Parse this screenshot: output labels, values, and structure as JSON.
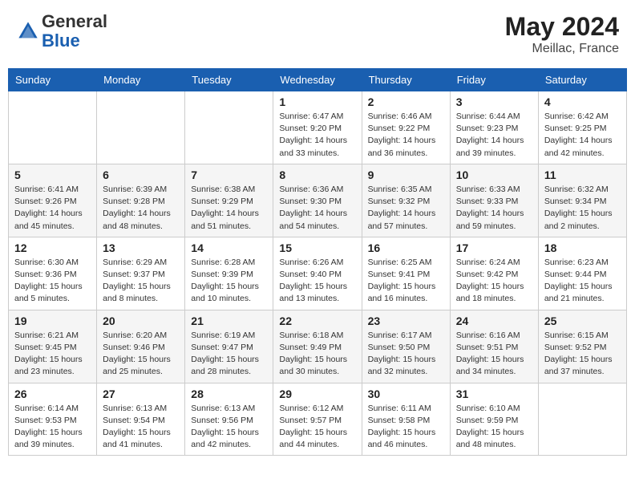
{
  "header": {
    "logo_general": "General",
    "logo_blue": "Blue",
    "month_year": "May 2024",
    "location": "Meillac, France"
  },
  "days_of_week": [
    "Sunday",
    "Monday",
    "Tuesday",
    "Wednesday",
    "Thursday",
    "Friday",
    "Saturday"
  ],
  "weeks": [
    [
      {
        "day": "",
        "sunrise": "",
        "sunset": "",
        "daylight": ""
      },
      {
        "day": "",
        "sunrise": "",
        "sunset": "",
        "daylight": ""
      },
      {
        "day": "",
        "sunrise": "",
        "sunset": "",
        "daylight": ""
      },
      {
        "day": "1",
        "sunrise": "Sunrise: 6:47 AM",
        "sunset": "Sunset: 9:20 PM",
        "daylight": "Daylight: 14 hours and 33 minutes."
      },
      {
        "day": "2",
        "sunrise": "Sunrise: 6:46 AM",
        "sunset": "Sunset: 9:22 PM",
        "daylight": "Daylight: 14 hours and 36 minutes."
      },
      {
        "day": "3",
        "sunrise": "Sunrise: 6:44 AM",
        "sunset": "Sunset: 9:23 PM",
        "daylight": "Daylight: 14 hours and 39 minutes."
      },
      {
        "day": "4",
        "sunrise": "Sunrise: 6:42 AM",
        "sunset": "Sunset: 9:25 PM",
        "daylight": "Daylight: 14 hours and 42 minutes."
      }
    ],
    [
      {
        "day": "5",
        "sunrise": "Sunrise: 6:41 AM",
        "sunset": "Sunset: 9:26 PM",
        "daylight": "Daylight: 14 hours and 45 minutes."
      },
      {
        "day": "6",
        "sunrise": "Sunrise: 6:39 AM",
        "sunset": "Sunset: 9:28 PM",
        "daylight": "Daylight: 14 hours and 48 minutes."
      },
      {
        "day": "7",
        "sunrise": "Sunrise: 6:38 AM",
        "sunset": "Sunset: 9:29 PM",
        "daylight": "Daylight: 14 hours and 51 minutes."
      },
      {
        "day": "8",
        "sunrise": "Sunrise: 6:36 AM",
        "sunset": "Sunset: 9:30 PM",
        "daylight": "Daylight: 14 hours and 54 minutes."
      },
      {
        "day": "9",
        "sunrise": "Sunrise: 6:35 AM",
        "sunset": "Sunset: 9:32 PM",
        "daylight": "Daylight: 14 hours and 57 minutes."
      },
      {
        "day": "10",
        "sunrise": "Sunrise: 6:33 AM",
        "sunset": "Sunset: 9:33 PM",
        "daylight": "Daylight: 14 hours and 59 minutes."
      },
      {
        "day": "11",
        "sunrise": "Sunrise: 6:32 AM",
        "sunset": "Sunset: 9:34 PM",
        "daylight": "Daylight: 15 hours and 2 minutes."
      }
    ],
    [
      {
        "day": "12",
        "sunrise": "Sunrise: 6:30 AM",
        "sunset": "Sunset: 9:36 PM",
        "daylight": "Daylight: 15 hours and 5 minutes."
      },
      {
        "day": "13",
        "sunrise": "Sunrise: 6:29 AM",
        "sunset": "Sunset: 9:37 PM",
        "daylight": "Daylight: 15 hours and 8 minutes."
      },
      {
        "day": "14",
        "sunrise": "Sunrise: 6:28 AM",
        "sunset": "Sunset: 9:39 PM",
        "daylight": "Daylight: 15 hours and 10 minutes."
      },
      {
        "day": "15",
        "sunrise": "Sunrise: 6:26 AM",
        "sunset": "Sunset: 9:40 PM",
        "daylight": "Daylight: 15 hours and 13 minutes."
      },
      {
        "day": "16",
        "sunrise": "Sunrise: 6:25 AM",
        "sunset": "Sunset: 9:41 PM",
        "daylight": "Daylight: 15 hours and 16 minutes."
      },
      {
        "day": "17",
        "sunrise": "Sunrise: 6:24 AM",
        "sunset": "Sunset: 9:42 PM",
        "daylight": "Daylight: 15 hours and 18 minutes."
      },
      {
        "day": "18",
        "sunrise": "Sunrise: 6:23 AM",
        "sunset": "Sunset: 9:44 PM",
        "daylight": "Daylight: 15 hours and 21 minutes."
      }
    ],
    [
      {
        "day": "19",
        "sunrise": "Sunrise: 6:21 AM",
        "sunset": "Sunset: 9:45 PM",
        "daylight": "Daylight: 15 hours and 23 minutes."
      },
      {
        "day": "20",
        "sunrise": "Sunrise: 6:20 AM",
        "sunset": "Sunset: 9:46 PM",
        "daylight": "Daylight: 15 hours and 25 minutes."
      },
      {
        "day": "21",
        "sunrise": "Sunrise: 6:19 AM",
        "sunset": "Sunset: 9:47 PM",
        "daylight": "Daylight: 15 hours and 28 minutes."
      },
      {
        "day": "22",
        "sunrise": "Sunrise: 6:18 AM",
        "sunset": "Sunset: 9:49 PM",
        "daylight": "Daylight: 15 hours and 30 minutes."
      },
      {
        "day": "23",
        "sunrise": "Sunrise: 6:17 AM",
        "sunset": "Sunset: 9:50 PM",
        "daylight": "Daylight: 15 hours and 32 minutes."
      },
      {
        "day": "24",
        "sunrise": "Sunrise: 6:16 AM",
        "sunset": "Sunset: 9:51 PM",
        "daylight": "Daylight: 15 hours and 34 minutes."
      },
      {
        "day": "25",
        "sunrise": "Sunrise: 6:15 AM",
        "sunset": "Sunset: 9:52 PM",
        "daylight": "Daylight: 15 hours and 37 minutes."
      }
    ],
    [
      {
        "day": "26",
        "sunrise": "Sunrise: 6:14 AM",
        "sunset": "Sunset: 9:53 PM",
        "daylight": "Daylight: 15 hours and 39 minutes."
      },
      {
        "day": "27",
        "sunrise": "Sunrise: 6:13 AM",
        "sunset": "Sunset: 9:54 PM",
        "daylight": "Daylight: 15 hours and 41 minutes."
      },
      {
        "day": "28",
        "sunrise": "Sunrise: 6:13 AM",
        "sunset": "Sunset: 9:56 PM",
        "daylight": "Daylight: 15 hours and 42 minutes."
      },
      {
        "day": "29",
        "sunrise": "Sunrise: 6:12 AM",
        "sunset": "Sunset: 9:57 PM",
        "daylight": "Daylight: 15 hours and 44 minutes."
      },
      {
        "day": "30",
        "sunrise": "Sunrise: 6:11 AM",
        "sunset": "Sunset: 9:58 PM",
        "daylight": "Daylight: 15 hours and 46 minutes."
      },
      {
        "day": "31",
        "sunrise": "Sunrise: 6:10 AM",
        "sunset": "Sunset: 9:59 PM",
        "daylight": "Daylight: 15 hours and 48 minutes."
      },
      {
        "day": "",
        "sunrise": "",
        "sunset": "",
        "daylight": ""
      }
    ]
  ]
}
